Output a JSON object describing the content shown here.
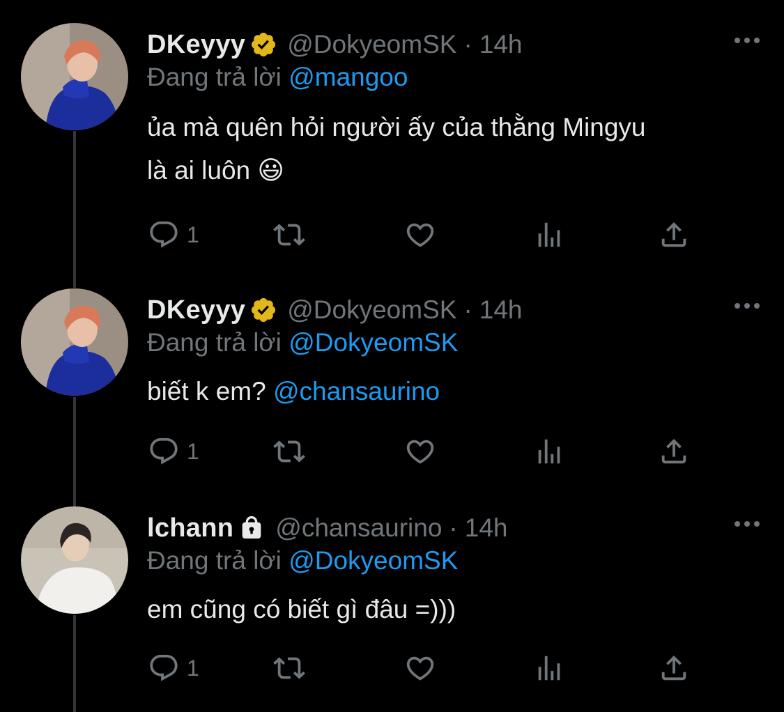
{
  "tweets": [
    {
      "name": "DKeyyy",
      "verified": true,
      "handle": "@DokyeomSK",
      "dot": "·",
      "time": "14h",
      "reply_prefix": "Đang trả lời",
      "reply_to": "@mangoo",
      "text_line1": "ủa mà quên hỏi người ấy của thằng Mingyu",
      "text_line2": "là ai luôn 😃",
      "reply_count": "1"
    },
    {
      "name": "DKeyyy",
      "verified": true,
      "handle": "@DokyeomSK",
      "dot": "·",
      "time": "14h",
      "reply_prefix": "Đang trả lời",
      "reply_to": "@DokyeomSK",
      "text_plain": "biết k em?",
      "text_mention": "@chansaurino",
      "reply_count": "1"
    },
    {
      "name": "lchann",
      "locked": true,
      "handle": "@chansaurino",
      "dot": "·",
      "time": "14h",
      "reply_prefix": "Đang trả lời",
      "reply_to": "@DokyeomSK",
      "text_line1": "em cũng có biết gì đâu =)))",
      "reply_count": "1"
    }
  ],
  "icons": {
    "verified": "verified-badge-icon",
    "lock": "lock-icon",
    "reply": "reply-icon",
    "retweet": "retweet-icon",
    "like": "heart-icon",
    "views": "views-icon",
    "share": "share-icon",
    "more": "more-icon"
  },
  "colors": {
    "background": "#000000",
    "text": "#e7e9ea",
    "muted": "#71767b",
    "link": "#1d9bf0",
    "verified_gold": "#e2b719"
  }
}
